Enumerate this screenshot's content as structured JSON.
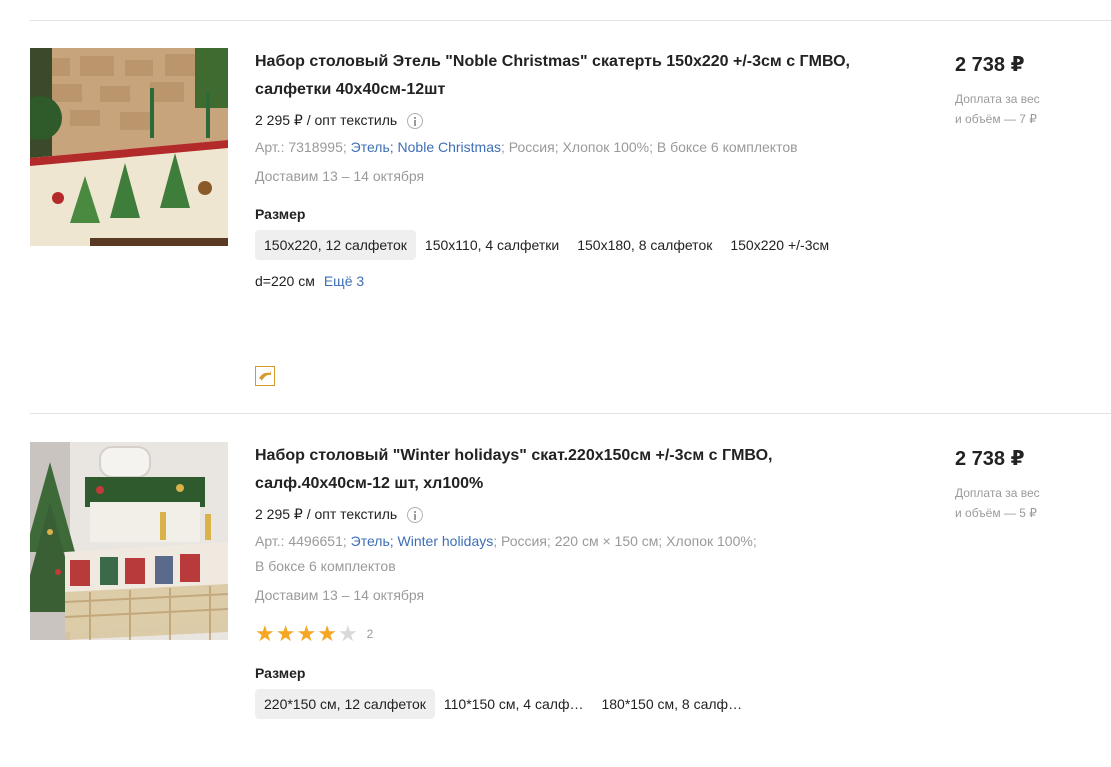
{
  "products": [
    {
      "title_line1": "Набор столовый Этель \"Noble Christmas\" скатерть 150x220 +/-3см с ГМВО,",
      "title_line2": "салфетки 40х40см-12шт",
      "wholesale_price": "2 295 ₽ / опт текстиль",
      "article": "Арт.: 7318995;",
      "brand": "Этель;",
      "collection": "Noble Christmas",
      "meta_rest": "; Россия; Хлопок 100%; В боксе 6 комплектов",
      "delivery": "Доставим 13 – 14 октября",
      "size_label": "Размер",
      "sizes": [
        "150x220, 12 салфеток",
        "150х110, 4 салфетки",
        "150х180, 8 салфеток",
        "150х220 +/-3см"
      ],
      "sizes_row2": "d=220 см",
      "more_sizes": "Ещё 3",
      "price": "2 738 ₽",
      "extra_line1": "Доплата за вес",
      "extra_line2": "и объём — 7 ₽",
      "badge_icon": "dolphin-icon"
    },
    {
      "title_line1": "Набор столовый \"Winter holidays\" скат.220х150см +/-3см с ГМВО,",
      "title_line2": "салф.40х40см-12 шт, хл100%",
      "wholesale_price": "2 295 ₽ / опт текстиль",
      "article": "Арт.: 4496651;",
      "brand": "Этель;",
      "collection": "Winter holidays",
      "meta_rest": "; Россия; 220 см × 150 см; Хлопок 100%;",
      "meta_line2": "В боксе 6 комплектов",
      "delivery": "Доставим 13 – 14 октября",
      "rating": 4,
      "rating_max": 5,
      "rating_count": "2",
      "size_label": "Размер",
      "sizes": [
        "220*150 см, 12 салфеток",
        "110*150 см, 4 салф…",
        "180*150 см, 8 салф…"
      ],
      "price": "2 738 ₽",
      "extra_line1": "Доплата за вес",
      "extra_line2": "и объём — 5 ₽"
    }
  ],
  "colors": {
    "link": "#3d6fb6",
    "star_filled": "#f5a623",
    "star_empty": "#d9d9d9",
    "badge": "#d89a2a"
  }
}
